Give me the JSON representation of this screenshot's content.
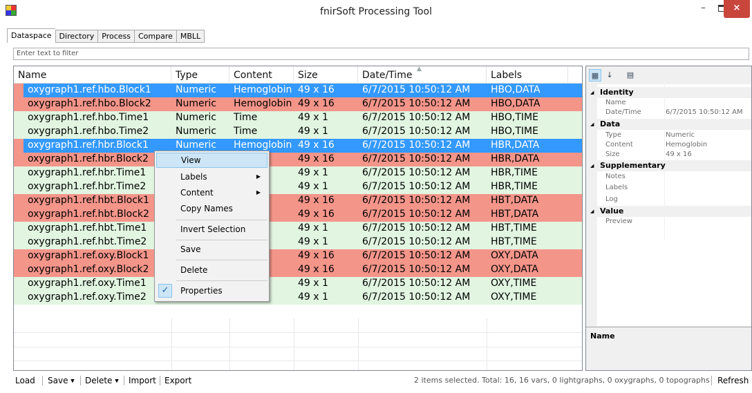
{
  "window": {
    "title": "fnirSoft Processing Tool",
    "min": "–",
    "close": "×"
  },
  "tabs": [
    "Dataspace",
    "Directory",
    "Process",
    "Compare",
    "MBLL"
  ],
  "filter": {
    "placeholder": "Enter text to filter"
  },
  "grid": {
    "columns": [
      "Name",
      "Type",
      "Content",
      "Size",
      "Date/Time",
      "Labels"
    ],
    "rows": [
      {
        "name": "oxygraph1.ref.hbo.Block1",
        "type": "Numeric",
        "content": "Hemoglobin",
        "size": "49 x 16",
        "datetime": "6/7/2015 10:50:12 AM",
        "labels": "HBO,DATA"
      },
      {
        "name": "oxygraph1.ref.hbo.Block2",
        "type": "Numeric",
        "content": "Hemoglobin",
        "size": "49 x 16",
        "datetime": "6/7/2015 10:50:12 AM",
        "labels": "HBO,DATA"
      },
      {
        "name": "oxygraph1.ref.hbo.Time1",
        "type": "Numeric",
        "content": "Time",
        "size": "49 x 1",
        "datetime": "6/7/2015 10:50:12 AM",
        "labels": "HBO,TIME"
      },
      {
        "name": "oxygraph1.ref.hbo.Time2",
        "type": "Numeric",
        "content": "Time",
        "size": "49 x 1",
        "datetime": "6/7/2015 10:50:12 AM",
        "labels": "HBO,TIME"
      },
      {
        "name": "oxygraph1.ref.hbr.Block1",
        "type": "Numeric",
        "content": "Hemoglobin",
        "size": "49 x 16",
        "datetime": "6/7/2015 10:50:12 AM",
        "labels": "HBR,DATA"
      },
      {
        "name": "oxygraph1.ref.hbr.Block2",
        "type": "",
        "content": "obin",
        "size": "49 x 16",
        "datetime": "6/7/2015 10:50:12 AM",
        "labels": "HBR,DATA"
      },
      {
        "name": "oxygraph1.ref.hbr.Time1",
        "type": "",
        "content": "",
        "size": "49 x 1",
        "datetime": "6/7/2015 10:50:12 AM",
        "labels": "HBR,TIME"
      },
      {
        "name": "oxygraph1.ref.hbr.Time2",
        "type": "",
        "content": "",
        "size": "49 x 1",
        "datetime": "6/7/2015 10:50:12 AM",
        "labels": "HBR,TIME"
      },
      {
        "name": "oxygraph1.ref.hbt.Block1",
        "type": "",
        "content": "obin",
        "size": "49 x 16",
        "datetime": "6/7/2015 10:50:12 AM",
        "labels": "HBT,DATA"
      },
      {
        "name": "oxygraph1.ref.hbt.Block2",
        "type": "",
        "content": "obin",
        "size": "49 x 16",
        "datetime": "6/7/2015 10:50:12 AM",
        "labels": "HBT,DATA"
      },
      {
        "name": "oxygraph1.ref.hbt.Time1",
        "type": "",
        "content": "",
        "size": "49 x 1",
        "datetime": "6/7/2015 10:50:12 AM",
        "labels": "HBT,TIME"
      },
      {
        "name": "oxygraph1.ref.hbt.Time2",
        "type": "",
        "content": "",
        "size": "49 x 1",
        "datetime": "6/7/2015 10:50:12 AM",
        "labels": "HBT,TIME"
      },
      {
        "name": "oxygraph1.ref.oxy.Block1",
        "type": "",
        "content": "obin",
        "size": "49 x 16",
        "datetime": "6/7/2015 10:50:12 AM",
        "labels": "OXY,DATA"
      },
      {
        "name": "oxygraph1.ref.oxy.Block2",
        "type": "",
        "content": "obin",
        "size": "49 x 16",
        "datetime": "6/7/2015 10:50:12 AM",
        "labels": "OXY,DATA"
      },
      {
        "name": "oxygraph1.ref.oxy.Time1",
        "type": "",
        "content": "",
        "size": "49 x 1",
        "datetime": "6/7/2015 10:50:12 AM",
        "labels": "OXY,TIME"
      },
      {
        "name": "oxygraph1.ref.oxy.Time2",
        "type": "Numeric",
        "content": "Time",
        "size": "49 x 1",
        "datetime": "6/7/2015 10:50:12 AM",
        "labels": "OXY,TIME"
      }
    ]
  },
  "context_menu": {
    "view": "View",
    "labels": "Labels",
    "content": "Content",
    "copy_names": "Copy Names",
    "invert_selection": "Invert Selection",
    "save": "Save",
    "delete": "Delete",
    "properties": "Properties",
    "submenu_arrow": "▶",
    "check": "✓"
  },
  "properties": {
    "categories": {
      "identity": "Identity",
      "data": "Data",
      "supplementary": "Supplementary",
      "value": "Value"
    },
    "props": {
      "name": "Name",
      "datetime": "Date/Time",
      "datetime_value": "6/7/2015 10:50:12 AM",
      "type": "Type",
      "type_value": "Numeric",
      "content": "Content",
      "content_value": "Hemoglobin",
      "size": "Size",
      "size_value": "49 x 16",
      "notes": "Notes",
      "labels": "Labels",
      "log": "Log",
      "preview": "Preview"
    },
    "description_title": "Name"
  },
  "statusbar": {
    "load": "Load",
    "save": "Save",
    "delete": "Delete",
    "import": "Import",
    "export": "Export",
    "status": "2 items selected. Total: 16, 16 vars, 0 lightgraphs, 0 oxygraphs, 0 topographs",
    "refresh": "Refresh"
  }
}
